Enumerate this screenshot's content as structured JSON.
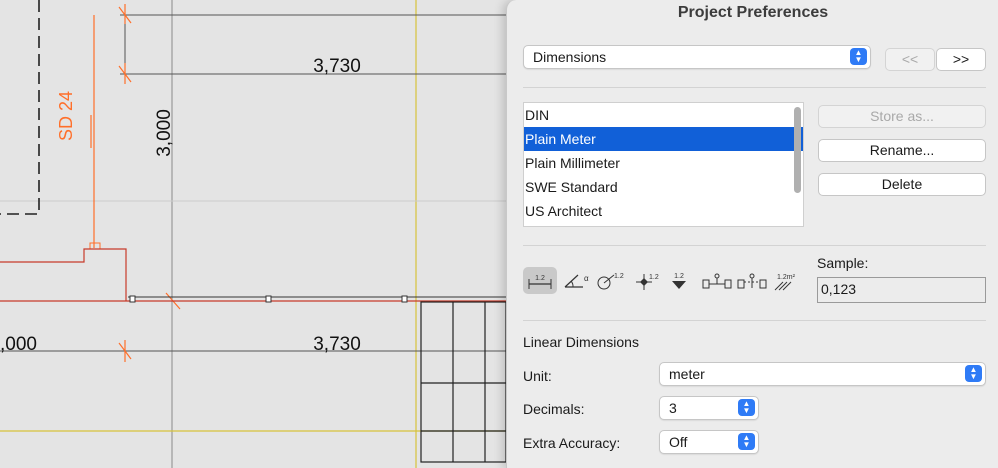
{
  "drawing": {
    "dimension_top": "3,730",
    "dimension_bottom": "3,730",
    "dimension_vertical": "3,000",
    "dimension_left": ",000",
    "wall_label": "SD 24"
  },
  "dialog": {
    "title": "Project Preferences",
    "section_popup": "Dimensions",
    "prev_label": "<<",
    "next_label": ">>",
    "standards": [
      "DIN",
      "Plain Meter",
      "Plain Millimeter",
      "SWE Standard",
      "US Architect"
    ],
    "selected_standard": "Plain Meter",
    "store_as_label": "Store as...",
    "rename_label": "Rename...",
    "delete_label": "Delete",
    "tool_icons": [
      "linear-dimension-icon",
      "angle-dimension-icon",
      "radial-dimension-icon",
      "level-dimension-icon",
      "elevation-dimension-icon",
      "door-window-dimension-icon",
      "sill-height-dimension-icon",
      "area-calculation-icon"
    ],
    "sample_label": "Sample:",
    "sample_value": "0,123",
    "linear_section": "Linear Dimensions",
    "unit_label": "Unit:",
    "unit_value": "meter",
    "decimals_label": "Decimals:",
    "decimals_value": "3",
    "extra_accuracy_label": "Extra Accuracy:",
    "extra_accuracy_value": "Off"
  },
  "colors": {
    "selection": "#1160d8",
    "accent": "#2f7bf6",
    "wall_orange": "#ff6f2a",
    "wall_red": "#c83a2a",
    "grid_yellow": "#d6c23a"
  }
}
